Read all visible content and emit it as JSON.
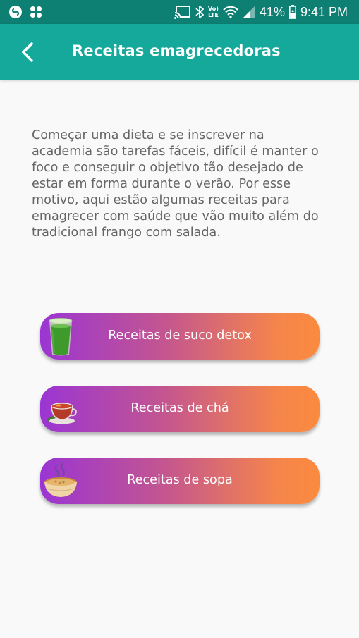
{
  "status_bar": {
    "left_icons": [
      "shazam-icon",
      "grid-app-icon"
    ],
    "right_icons": [
      "cast-icon",
      "bluetooth-icon",
      "volte-icon",
      "wifi-icon",
      "signal-icon",
      "battery-icon"
    ],
    "volte_line1": "Vo)",
    "volte_line2": "LTE",
    "battery": "41%",
    "time": "9:41 PM"
  },
  "app_bar": {
    "title": "Receitas emagrecedoras",
    "back_icon": "back-arrow-icon",
    "color": "#14a99a"
  },
  "intro_text": "Começar uma dieta e se inscrever na academia são tarefas fáceis, difícil é manter o foco e conseguir o objetivo tão desejado de estar em forma durante o verão. Por esse motivo, aqui estão algumas receitas para emagrecer com saúde que vão muito além do tradicional frango com salada.",
  "buttons": [
    {
      "label": "Receitas de suco detox",
      "icon": "green-juice-icon"
    },
    {
      "label": "Receitas de chá",
      "icon": "tea-cup-icon"
    },
    {
      "label": "Receitas de sopa",
      "icon": "soup-bowl-icon"
    }
  ],
  "colors": {
    "status_bar": "#0e7f73",
    "gradient_start": "#9b35d3",
    "gradient_end": "#fb8a3f",
    "body_text": "#666666"
  }
}
